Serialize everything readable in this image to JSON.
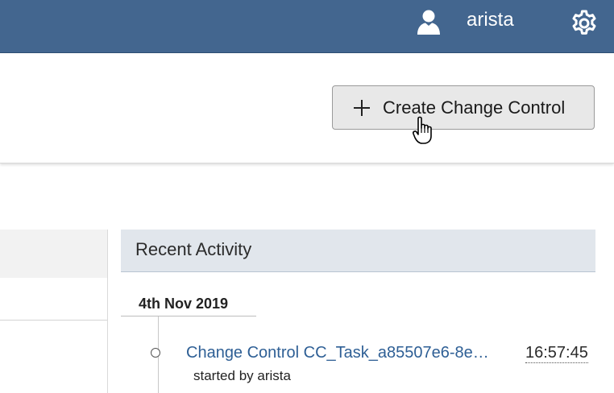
{
  "topbar": {
    "username": "arista",
    "icons": {
      "user": "user-icon",
      "settings": "gear-icon"
    },
    "colors": {
      "background": "#43668f",
      "text": "#ffffff"
    }
  },
  "toolbar": {
    "create_button_label": "Create Change Control",
    "create_button_icon": "plus-icon"
  },
  "recent_activity": {
    "title": "Recent Activity",
    "groups": [
      {
        "date": "4th Nov 2019",
        "items": [
          {
            "title": "Change Control CC_Task_a85507e6-8e…",
            "time": "16:57:45",
            "subtitle": "started by arista"
          }
        ]
      }
    ]
  },
  "colors": {
    "link": "#2e5f95",
    "panel_header": "#e1e6ec"
  }
}
